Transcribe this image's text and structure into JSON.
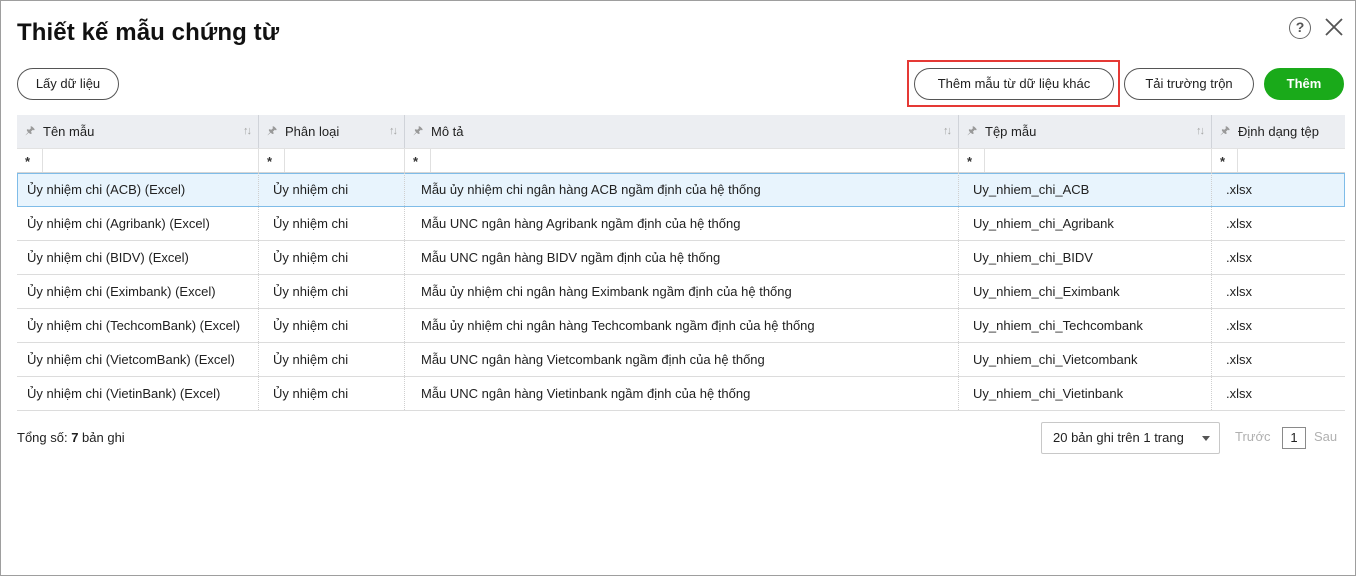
{
  "dialog": {
    "title": "Thiết kế mẫu chứng từ",
    "help_glyph": "?"
  },
  "toolbar": {
    "get_data_label": "Lấy dữ liệu",
    "add_from_other_label": "Thêm mẫu từ dữ liệu khác",
    "load_merge_fields_label": "Tải trường trộn",
    "add_label": "Thêm",
    "add_color": "#1aaa1a",
    "highlight_color": "#e53935"
  },
  "table": {
    "columns": [
      "Tên mẫu",
      "Phân loại",
      "Mô tả",
      "Tệp mẫu",
      "Định dạng tệp"
    ],
    "filter_marker": "*",
    "rows": [
      [
        "Ủy nhiệm chi (ACB) (Excel)",
        "Ủy nhiệm chi",
        "Mẫu ủy nhiệm chi ngân hàng ACB ngầm định của hệ thống",
        "Uy_nhiem_chi_ACB",
        ".xlsx"
      ],
      [
        "Ủy nhiệm chi (Agribank) (Excel)",
        "Ủy nhiệm chi",
        "Mẫu UNC ngân hàng Agribank ngầm định của hệ thống",
        "Uy_nhiem_chi_Agribank",
        ".xlsx"
      ],
      [
        "Ủy nhiệm chi (BIDV) (Excel)",
        "Ủy nhiệm chi",
        "Mẫu UNC ngân hàng BIDV ngầm định của hệ thống",
        "Uy_nhiem_chi_BIDV",
        ".xlsx"
      ],
      [
        "Ủy nhiệm chi (Eximbank) (Excel)",
        "Ủy nhiệm chi",
        "Mẫu ủy nhiệm chi ngân hàng Eximbank ngầm định của hệ thống",
        "Uy_nhiem_chi_Eximbank",
        ".xlsx"
      ],
      [
        "Ủy nhiệm chi (TechcomBank) (Excel)",
        "Ủy nhiệm chi",
        "Mẫu ủy nhiệm chi ngân hàng Techcombank ngầm định của hệ thống",
        "Uy_nhiem_chi_Techcombank",
        ".xlsx"
      ],
      [
        "Ủy nhiệm chi (VietcomBank) (Excel)",
        "Ủy nhiệm chi",
        "Mẫu UNC ngân hàng Vietcombank ngầm định của hệ thống",
        "Uy_nhiem_chi_Vietcombank",
        ".xlsx"
      ],
      [
        "Ủy nhiệm chi (VietinBank) (Excel)",
        "Ủy nhiệm chi",
        "Mẫu UNC ngân hàng Vietinbank ngầm định của hệ thống",
        "Uy_nhiem_chi_Vietinbank",
        ".xlsx"
      ]
    ],
    "selected_row": 0,
    "selected_color": "#e8f4fd"
  },
  "footer": {
    "total_label": "Tổng số: ",
    "total_count": "7",
    "total_unit": " bản ghi",
    "page_size_label": "20 bản ghi trên 1 trang",
    "prev_label": "Trước",
    "current_page": "1",
    "next_label": "Sau"
  }
}
